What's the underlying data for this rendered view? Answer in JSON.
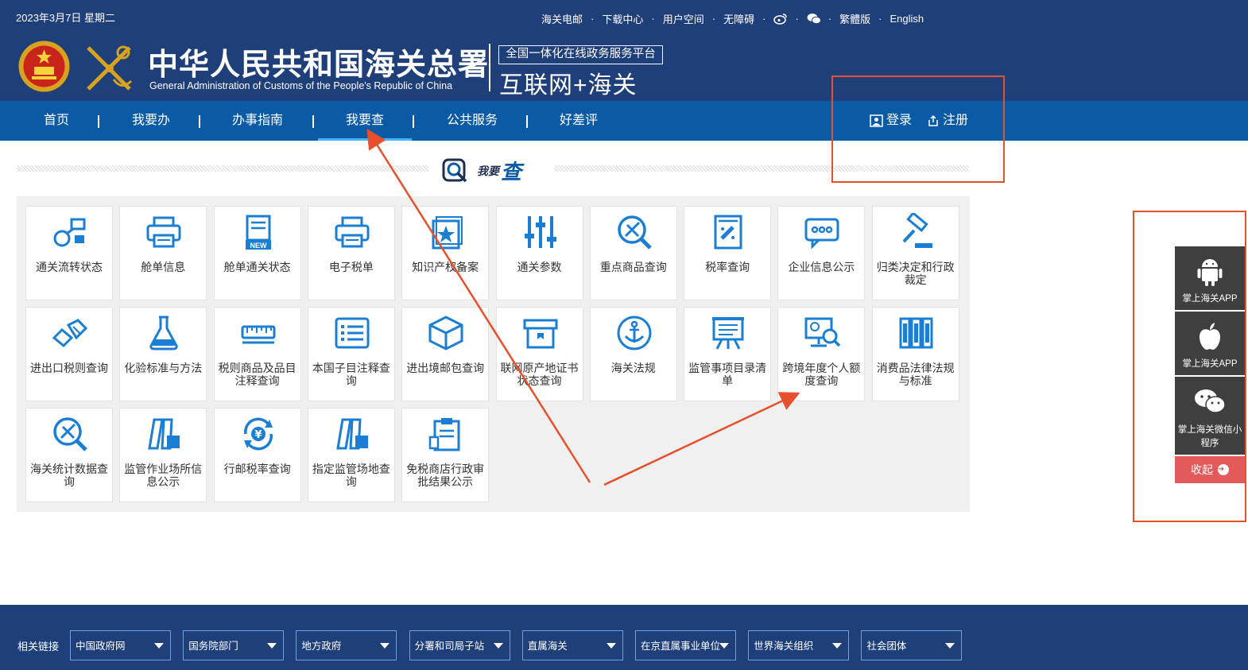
{
  "header": {
    "date": "2023年3月7日  星期二",
    "top_links": [
      "海关电邮",
      "下载中心",
      "用户空间",
      "无障碍"
    ],
    "lang_links": [
      "繁體版",
      "English"
    ],
    "icons": [
      "weibo-icon",
      "wechat-icon"
    ],
    "title_cn": "中华人民共和国海关总署",
    "title_en": "General Administration of Customs of the People's Republic of China",
    "platform": "全国一体化在线政务服务平台",
    "platform_name": "互联网+海关"
  },
  "nav": {
    "items": [
      "首页",
      "我要办",
      "办事指南",
      "我要查",
      "公共服务",
      "好差评"
    ],
    "active": "我要查",
    "login": "登录",
    "register": "注册"
  },
  "section": {
    "title_small": "我要",
    "title_big": "查"
  },
  "tiles": [
    {
      "label": "通关流转状态",
      "icon": "flow-icon"
    },
    {
      "label": "舱单信息",
      "icon": "printer-icon"
    },
    {
      "label": "舱单通关状态",
      "icon": "new-doc-icon"
    },
    {
      "label": "电子税单",
      "icon": "printer-icon"
    },
    {
      "label": "知识产权备案",
      "icon": "star-doc-icon"
    },
    {
      "label": "通关参数",
      "icon": "sliders-icon"
    },
    {
      "label": "重点商品查询",
      "icon": "search-tools-icon"
    },
    {
      "label": "税率查询",
      "icon": "rate-icon"
    },
    {
      "label": "企业信息公示",
      "icon": "chat-icon"
    },
    {
      "label": "归类决定和行政裁定",
      "icon": "gavel-icon"
    },
    {
      "label": "进出口税则查询",
      "icon": "hands-icon"
    },
    {
      "label": "化验标准与方法",
      "icon": "flask-icon"
    },
    {
      "label": "税则商品及品目注释查询",
      "icon": "ruler-icon"
    },
    {
      "label": "本国子目注释查询",
      "icon": "list-icon"
    },
    {
      "label": "进出境邮包查询",
      "icon": "box-icon"
    },
    {
      "label": "联网原产地证书状态查询",
      "icon": "tray-icon"
    },
    {
      "label": "海关法规",
      "icon": "anchor-icon"
    },
    {
      "label": "监管事项目录清单",
      "icon": "easel-icon"
    },
    {
      "label": "跨境年度个人额度查询",
      "icon": "monitor-search-icon"
    },
    {
      "label": "消费品法律法规与标准",
      "icon": "books-icon"
    },
    {
      "label": "海关统计数据查询",
      "icon": "search-tools-icon"
    },
    {
      "label": "监管作业场所信息公示",
      "icon": "building-icon"
    },
    {
      "label": "行邮税率查询",
      "icon": "yuan-cycle-icon"
    },
    {
      "label": "指定监管场地查询",
      "icon": "building-icon"
    },
    {
      "label": "免税商店行政审批结果公示",
      "icon": "clipboard-icon"
    }
  ],
  "side_panel": {
    "android": "掌上海关APP",
    "ios": "掌上海关APP",
    "wechat": "掌上海关微信小程序",
    "collapse": "收起"
  },
  "footer": {
    "label": "相关链接",
    "selects": [
      "中国政府网",
      "国务院部门",
      "地方政府",
      "分署和司局子站",
      "直属海关",
      "在京直属事业单位",
      "世界海关组织",
      "社会团体"
    ]
  },
  "colors": {
    "header": "#1f3f7a",
    "nav": "#0b5aa5",
    "accent": "#1a7fd4",
    "annotation": "#e8502c",
    "collapse": "#e45a5a"
  }
}
